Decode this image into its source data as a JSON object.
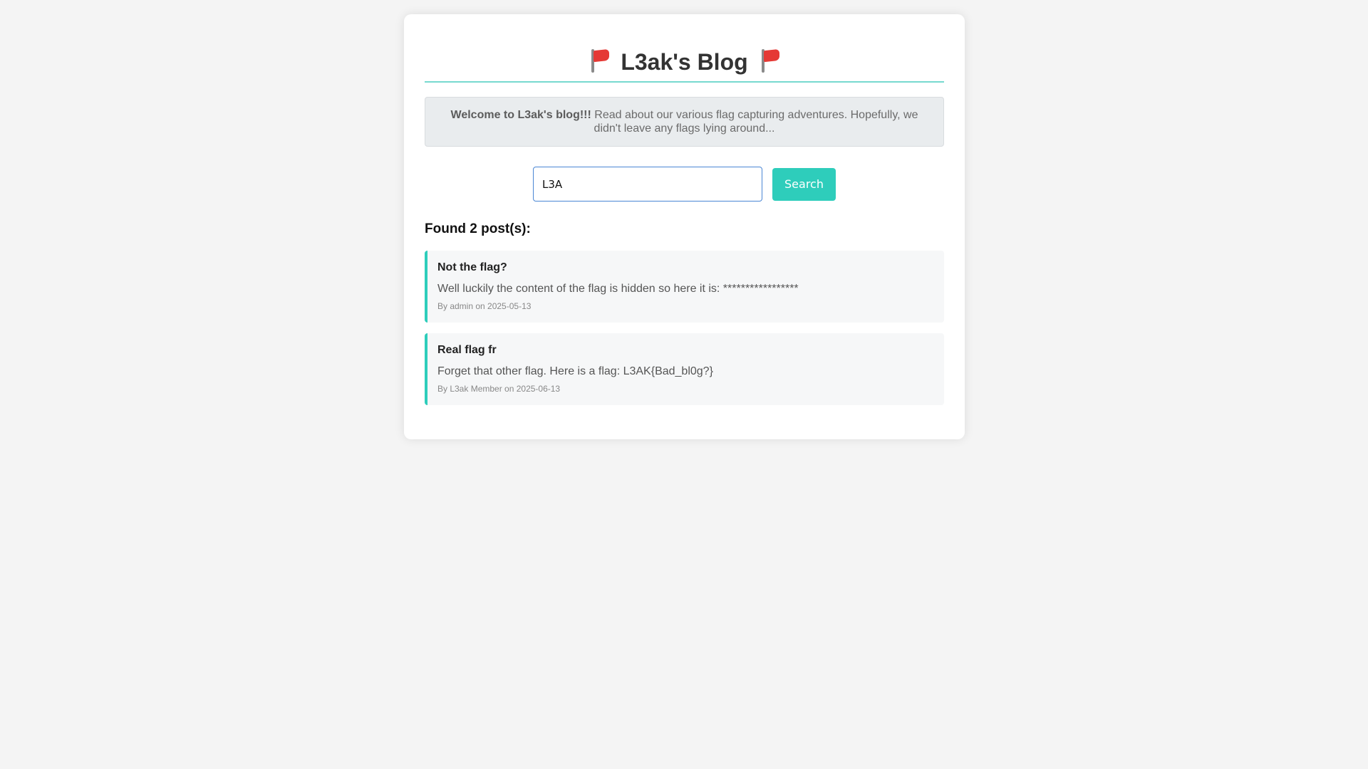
{
  "header": {
    "title": "L3ak's Blog",
    "left_icon": "red-flag-icon",
    "right_icon": "red-flag-icon"
  },
  "welcome": {
    "bold": "Welcome to L3ak's blog!!!",
    "text": " Read about our various flag capturing adventures. Hopefully, we didn't leave any flags lying around..."
  },
  "search": {
    "value": "L3A",
    "button_label": "Search"
  },
  "results": {
    "title": "Found 2 post(s):"
  },
  "posts": [
    {
      "title": "Not the flag?",
      "body": "Well luckily the content of the flag is hidden so here it is: *****************",
      "meta": "By admin on 2025-05-13"
    },
    {
      "title": "Real flag fr",
      "body": "Forget that other flag. Here is a flag: L3AK{Bad_bl0g?}",
      "meta": "By L3ak Member on 2025-06-13"
    }
  ],
  "colors": {
    "accent": "#2ecdbb",
    "header_rule": "#76d9cf",
    "flag": "#e53935",
    "page_background": "#f4f4f4"
  }
}
